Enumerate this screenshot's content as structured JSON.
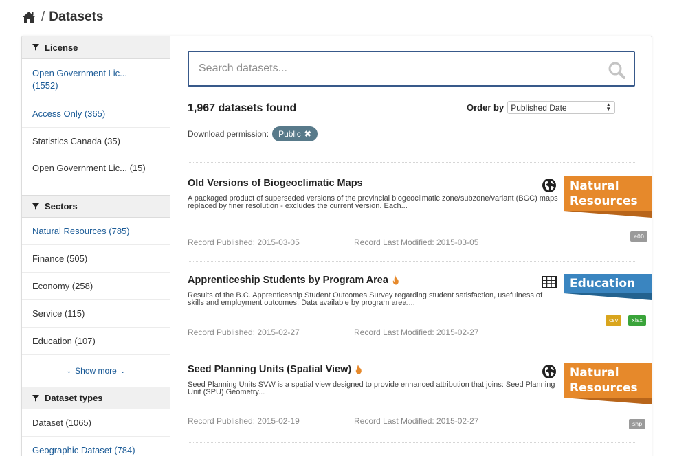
{
  "breadcrumb": {
    "separator": "/",
    "current": "Datasets"
  },
  "sidebar": {
    "license": {
      "heading": "License",
      "items": [
        {
          "label": "Open Government Lic... (1552)"
        },
        {
          "label": "Access Only (365)"
        },
        {
          "label": "Statistics Canada (35)"
        },
        {
          "label": "Open Government Lic... (15)"
        }
      ]
    },
    "sectors": {
      "heading": "Sectors",
      "items": [
        {
          "label": "Natural Resources (785)"
        },
        {
          "label": "Finance (505)"
        },
        {
          "label": "Economy (258)"
        },
        {
          "label": "Service (115)"
        },
        {
          "label": "Education (107)"
        }
      ],
      "show_more": "Show more"
    },
    "dataset_types": {
      "heading": "Dataset types",
      "items": [
        {
          "label": "Dataset (1065)"
        },
        {
          "label": "Geographic Dataset (784)"
        }
      ]
    }
  },
  "search": {
    "placeholder": "Search datasets..."
  },
  "results_count": "1,967 datasets found",
  "order": {
    "label": "Order by",
    "selected": "Published Date"
  },
  "filter": {
    "label": "Download permission:",
    "pill": "Public"
  },
  "results": [
    {
      "title": "Old Versions of Biogeoclimatic Maps",
      "description": "A packaged product of superseded versions of the provincial biogeoclimatic zone/subzone/variant (BGC) maps replaced by finer resolution - excludes the current version. Each...",
      "published": "Record Published: 2015-03-05",
      "modified": "Record Last Modified: 2015-03-05",
      "sector": "Natural Resources",
      "formats": [
        "e00"
      ]
    },
    {
      "title": "Apprenticeship Students by Program Area",
      "description": "Results of the B.C. Apprenticeship Student Outcomes Survey regarding student satisfaction, usefulness of skills and employment outcomes. Data available by program area....",
      "published": "Record Published: 2015-02-27",
      "modified": "Record Last Modified: 2015-02-27",
      "sector": "Education",
      "formats": [
        "csv",
        "xlsx"
      ]
    },
    {
      "title": "Seed Planning Units (Spatial View)",
      "description": "Seed Planning Units SVW is a spatial view designed to provide enhanced attribution that joins: Seed Planning Unit (SPU) Geometry...",
      "published": "Record Published: 2015-02-19",
      "modified": "Record Last Modified: 2015-02-27",
      "sector": "Natural Resources",
      "formats": [
        "shp"
      ]
    }
  ],
  "colors": {
    "orange_sector": "#e6892b",
    "blue_sector": "#3a85c0",
    "link": "#1a5a96",
    "pill": "#587a8a",
    "search_border": "#38598a"
  }
}
